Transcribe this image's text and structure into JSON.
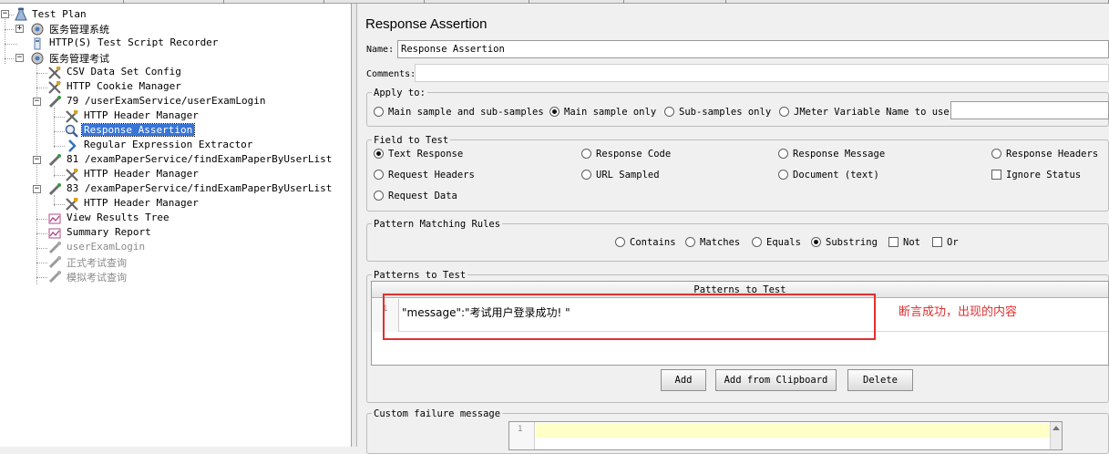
{
  "tree": {
    "items": [
      {
        "label": "Test Plan",
        "icon": "test-plan-icon",
        "state": "normal"
      },
      {
        "label": "医务管理系统",
        "icon": "thread-group-icon",
        "state": "normal"
      },
      {
        "label": "HTTP(S) Test Script Recorder",
        "icon": "recorder-icon",
        "state": "normal"
      },
      {
        "label": "医务管理考试",
        "icon": "thread-group-icon",
        "state": "normal"
      },
      {
        "label": "CSV Data Set Config",
        "icon": "config-wrench-icon",
        "state": "normal"
      },
      {
        "label": "HTTP Cookie Manager",
        "icon": "config-wrench-icon",
        "state": "normal"
      },
      {
        "label": "79 /userExamService/userExamLogin",
        "icon": "sampler-pipette-icon",
        "state": "normal"
      },
      {
        "label": "HTTP Header Manager",
        "icon": "config-wrench-icon",
        "state": "normal"
      },
      {
        "label": "Response Assertion",
        "icon": "assertion-magnifier-icon",
        "state": "selected"
      },
      {
        "label": "Regular Expression Extractor",
        "icon": "extractor-arrow-icon",
        "state": "normal"
      },
      {
        "label": "81 /examPaperService/findExamPaperByUserList",
        "icon": "sampler-pipette-icon",
        "state": "normal"
      },
      {
        "label": "HTTP Header Manager",
        "icon": "config-wrench-icon",
        "state": "normal"
      },
      {
        "label": "83 /examPaperService/findExamPaperByUserList",
        "icon": "sampler-pipette-icon",
        "state": "normal"
      },
      {
        "label": "HTTP Header Manager",
        "icon": "config-wrench-icon",
        "state": "normal"
      },
      {
        "label": "View Results Tree",
        "icon": "listener-chart-icon",
        "state": "normal"
      },
      {
        "label": "Summary Report",
        "icon": "listener-chart-icon",
        "state": "normal"
      },
      {
        "label": "userExamLogin",
        "icon": "sampler-pipette-icon",
        "state": "disabled"
      },
      {
        "label": "正式考试查询",
        "icon": "sampler-pipette-icon",
        "state": "disabled"
      },
      {
        "label": "模拟考试查询",
        "icon": "sampler-pipette-icon",
        "state": "disabled"
      }
    ]
  },
  "panel": {
    "title": "Response Assertion",
    "name_label": "Name:",
    "name_value": "Response Assertion",
    "comments_label": "Comments:",
    "comments_value": ""
  },
  "apply_to": {
    "title": "Apply to:",
    "options": [
      "Main sample and sub-samples",
      "Main sample only",
      "Sub-samples only",
      "JMeter Variable Name to use"
    ],
    "selected": "Main sample only",
    "variable_value": ""
  },
  "field_to_test": {
    "title": "Field to Test",
    "options": [
      "Text Response",
      "Response Code",
      "Response Message",
      "Response Headers",
      "Request Headers",
      "URL Sampled",
      "Document (text)",
      "Request Data"
    ],
    "ignore_status_label": "Ignore Status",
    "ignore_status_checked": false,
    "selected": "Text Response"
  },
  "pattern_matching": {
    "title": "Pattern Matching Rules",
    "options": [
      "Contains",
      "Matches",
      "Equals",
      "Substring"
    ],
    "selected": "Substring",
    "not_label": "Not",
    "or_label": "Or",
    "not_checked": false,
    "or_checked": false
  },
  "patterns": {
    "title": "Patterns to Test",
    "column_header": "Patterns to Test",
    "rows": [
      {
        "number": "1",
        "value": "\"message\":\"考试用户登录成功! \""
      }
    ],
    "annotation": "断言成功，出现的内容",
    "annotation_color": "#e03030",
    "add_label": "Add",
    "add_clipboard_label": "Add from Clipboard",
    "delete_label": "Delete"
  },
  "custom_failure": {
    "title": "Custom failure message",
    "line_number": "1",
    "value": ""
  },
  "colors": {
    "selection": "#3875d7",
    "highlight_box": "#e03030",
    "editor_line": "#ffffc8"
  }
}
